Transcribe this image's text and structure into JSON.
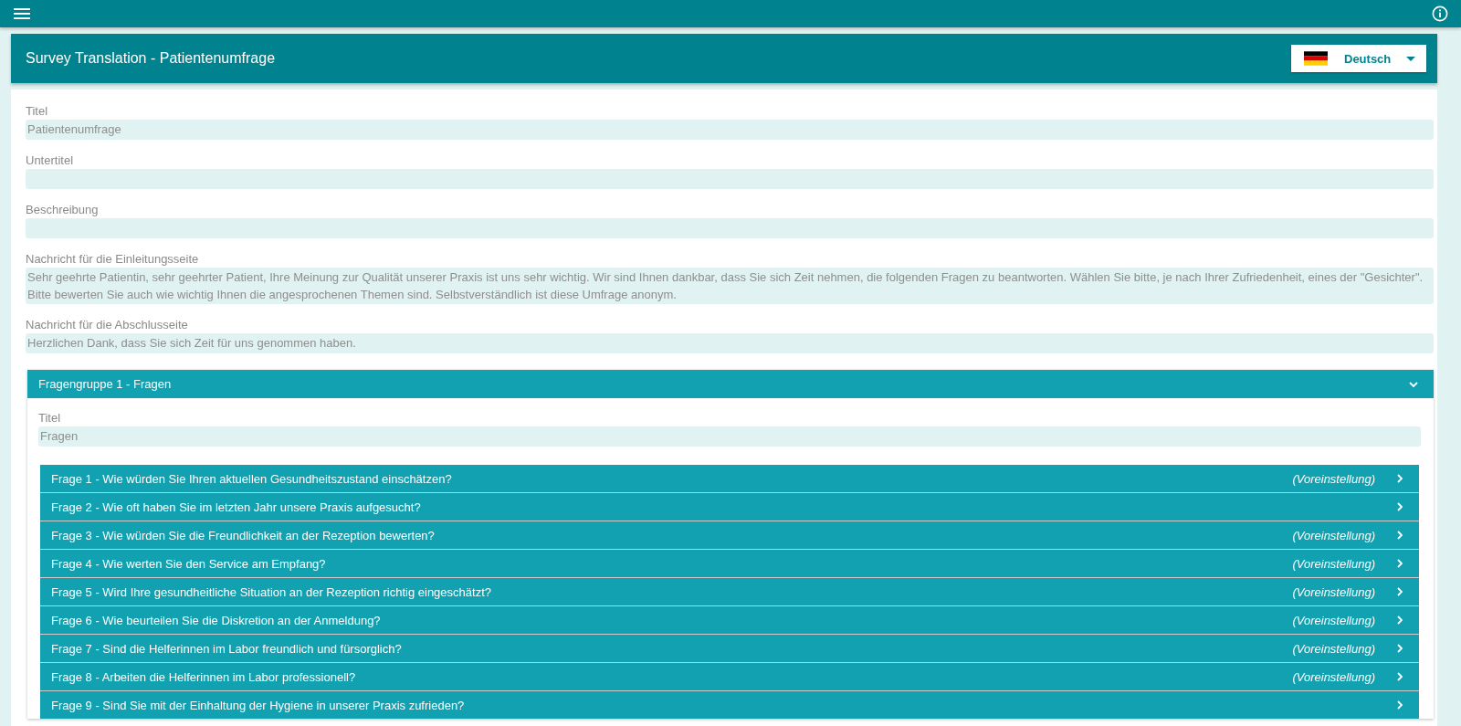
{
  "header": {
    "title": "Survey Translation - Patientenumfrage",
    "language": {
      "label": "Deutsch"
    }
  },
  "fields": [
    {
      "label": "Titel",
      "value": "Patientenumfrage"
    },
    {
      "label": "Untertitel"
    },
    {
      "label": "Beschreibung"
    },
    {
      "label": "Nachricht für die Einleitungsseite",
      "value": "Sehr geehrte Patientin, sehr geehrter Patient, Ihre Meinung zur Qualität unserer Praxis ist uns sehr wichtig. Wir sind Ihnen dankbar, dass Sie sich Zeit nehmen, die folgenden Fragen zu beantworten. Wählen Sie bitte, je nach Ihrer Zufriedenheit, eines der \"Gesichter\". Bitte bewerten Sie auch wie wichtig Ihnen die angesprochenen Themen sind. Selbstverständlich ist diese Umfrage anonym."
    },
    {
      "label": "Nachricht für die Abschlusseite",
      "value": "Herzlichen Dank, dass Sie sich Zeit für uns genommen haben."
    }
  ],
  "group": {
    "title": "Fragengruppe 1 - Fragen",
    "expanded": true,
    "field": {
      "label": "Titel",
      "value": "Fragen"
    },
    "questions": [
      {
        "label": "Frage 1 - Wie würden Sie Ihren aktuellen Gesundheitszustand einschätzen?",
        "note": "(Voreinstellung)"
      },
      {
        "label": "Frage 2 - Wie oft haben Sie im letzten Jahr unsere Praxis aufgesucht?"
      },
      {
        "label": "Frage 3 - Wie würden Sie die Freundlichkeit an der Rezeption bewerten?",
        "note": "(Voreinstellung)"
      },
      {
        "label": "Frage 4 - Wie werten Sie den Service am Empfang?",
        "note": "(Voreinstellung)"
      },
      {
        "label": "Frage 5 - Wird Ihre gesundheitliche Situation an der Rezeption richtig eingeschätzt?",
        "note": "(Voreinstellung)"
      },
      {
        "label": "Frage 6 - Wie beurteilen Sie die Diskretion an der Anmeldung?",
        "note": "(Voreinstellung)"
      },
      {
        "label": "Frage 7 - Sind die Helferinnen im Labor freundlich und fürsorglich?",
        "note": "(Voreinstellung)"
      },
      {
        "label": "Frage 8 - Arbeiten die Helferinnen im Labor professionell?",
        "note": "(Voreinstellung)"
      },
      {
        "label": "Frage 9 - Sind Sie mit der Einhaltung der Hygiene in unserer Praxis zufrieden?"
      }
    ]
  }
}
